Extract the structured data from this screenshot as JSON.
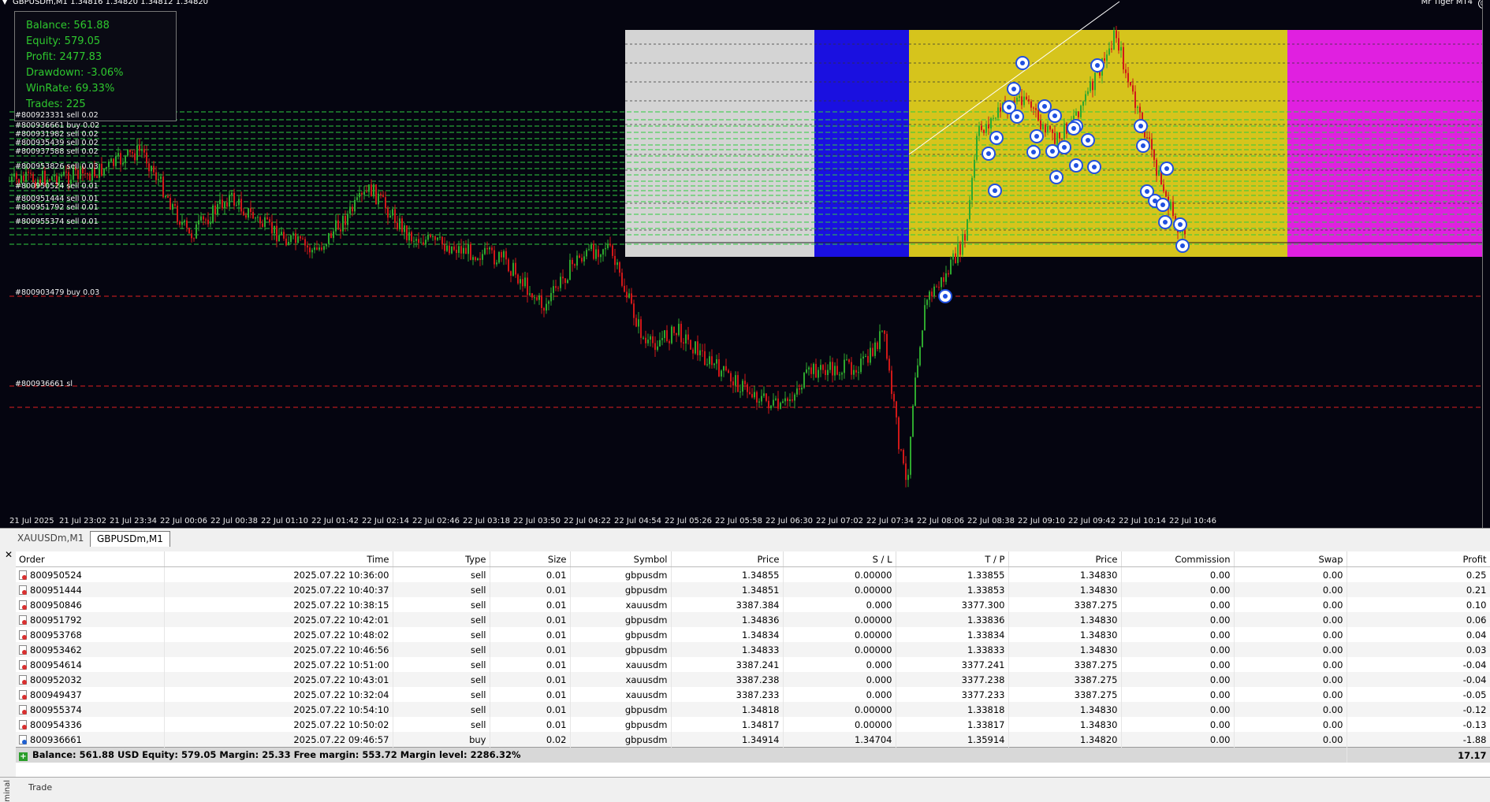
{
  "chart": {
    "symbol_header": "GBPUSDm,M1  1.34816 1.34820 1.34812 1.34820",
    "ea_name": "Mr Tiger MT4",
    "info_panel": [
      "Balance: 561.88",
      "Equity: 579.05",
      "Profit: 2477.83",
      "Drawdown: -3.06%",
      "WinRate: 69.33%",
      "Trades: 225"
    ],
    "order_labels": [
      {
        "text": "#800923331 sell 0.02"
      },
      {
        "text": "#800936661 buy 0.02"
      },
      {
        "text": "#800931982 sell 0.02"
      },
      {
        "text": "#800935439 sell 0.02"
      },
      {
        "text": "#800937588 sell 0.02"
      },
      {
        "text": "#800953826 sell 0.03"
      },
      {
        "text": "#800950524 sell 0.01"
      },
      {
        "text": "#800951444 sell 0.01"
      },
      {
        "text": "#800951792 sell 0.01"
      },
      {
        "text": "#800955374 sell 0.01"
      },
      {
        "text": "#800903479 buy 0.03"
      },
      {
        "text": "#800936661 sl"
      }
    ],
    "time_labels": [
      "21 Jul 2025",
      "21 Jul 23:02",
      "21 Jul 23:34",
      "22 Jul 00:06",
      "22 Jul 00:38",
      "22 Jul 01:10",
      "22 Jul 01:42",
      "22 Jul 02:14",
      "22 Jul 02:46",
      "22 Jul 03:18",
      "22 Jul 03:50",
      "22 Jul 04:22",
      "22 Jul 04:54",
      "22 Jul 05:26",
      "22 Jul 05:58",
      "22 Jul 06:30",
      "22 Jul 07:02",
      "22 Jul 07:34",
      "22 Jul 08:06",
      "22 Jul 08:38",
      "22 Jul 09:10",
      "22 Jul 09:42",
      "22 Jul 10:14",
      "22 Jul 10:46"
    ],
    "zone_colors": {
      "gray": "#d4d4d4",
      "blue": "#1a10e0",
      "yellow": "#d6c41c",
      "magenta": "#e020e0"
    },
    "candle_up_color": "#2ea82e",
    "candle_down_color": "#d01818"
  },
  "tabs": [
    "XAUUSDm,M1",
    "GBPUSDm,M1"
  ],
  "active_tab": "GBPUSDm,M1",
  "terminal": {
    "columns": [
      "Order",
      "Time",
      "Type",
      "Size",
      "Symbol",
      "Price",
      "S / L",
      "T / P",
      "Price",
      "Commission",
      "Swap",
      "Profit"
    ],
    "rows": [
      {
        "order": "800950524",
        "time": "2025.07.22 10:36:00",
        "type": "sell",
        "size": "0.01",
        "symbol": "gbpusdm",
        "price": "1.34855",
        "sl": "0.00000",
        "tp": "1.33855",
        "cur": "1.34830",
        "comm": "0.00",
        "swap": "0.00",
        "profit": "0.25"
      },
      {
        "order": "800951444",
        "time": "2025.07.22 10:40:37",
        "type": "sell",
        "size": "0.01",
        "symbol": "gbpusdm",
        "price": "1.34851",
        "sl": "0.00000",
        "tp": "1.33853",
        "cur": "1.34830",
        "comm": "0.00",
        "swap": "0.00",
        "profit": "0.21"
      },
      {
        "order": "800950846",
        "time": "2025.07.22 10:38:15",
        "type": "sell",
        "size": "0.01",
        "symbol": "xauusdm",
        "price": "3387.384",
        "sl": "0.000",
        "tp": "3377.300",
        "cur": "3387.275",
        "comm": "0.00",
        "swap": "0.00",
        "profit": "0.10"
      },
      {
        "order": "800951792",
        "time": "2025.07.22 10:42:01",
        "type": "sell",
        "size": "0.01",
        "symbol": "gbpusdm",
        "price": "1.34836",
        "sl": "0.00000",
        "tp": "1.33836",
        "cur": "1.34830",
        "comm": "0.00",
        "swap": "0.00",
        "profit": "0.06"
      },
      {
        "order": "800953768",
        "time": "2025.07.22 10:48:02",
        "type": "sell",
        "size": "0.01",
        "symbol": "gbpusdm",
        "price": "1.34834",
        "sl": "0.00000",
        "tp": "1.33834",
        "cur": "1.34830",
        "comm": "0.00",
        "swap": "0.00",
        "profit": "0.04"
      },
      {
        "order": "800953462",
        "time": "2025.07.22 10:46:56",
        "type": "sell",
        "size": "0.01",
        "symbol": "gbpusdm",
        "price": "1.34833",
        "sl": "0.00000",
        "tp": "1.33833",
        "cur": "1.34830",
        "comm": "0.00",
        "swap": "0.00",
        "profit": "0.03"
      },
      {
        "order": "800954614",
        "time": "2025.07.22 10:51:00",
        "type": "sell",
        "size": "0.01",
        "symbol": "xauusdm",
        "price": "3387.241",
        "sl": "0.000",
        "tp": "3377.241",
        "cur": "3387.275",
        "comm": "0.00",
        "swap": "0.00",
        "profit": "-0.04"
      },
      {
        "order": "800952032",
        "time": "2025.07.22 10:43:01",
        "type": "sell",
        "size": "0.01",
        "symbol": "xauusdm",
        "price": "3387.238",
        "sl": "0.000",
        "tp": "3377.238",
        "cur": "3387.275",
        "comm": "0.00",
        "swap": "0.00",
        "profit": "-0.04"
      },
      {
        "order": "800949437",
        "time": "2025.07.22 10:32:04",
        "type": "sell",
        "size": "0.01",
        "symbol": "xauusdm",
        "price": "3387.233",
        "sl": "0.000",
        "tp": "3377.233",
        "cur": "3387.275",
        "comm": "0.00",
        "swap": "0.00",
        "profit": "-0.05"
      },
      {
        "order": "800955374",
        "time": "2025.07.22 10:54:10",
        "type": "sell",
        "size": "0.01",
        "symbol": "gbpusdm",
        "price": "1.34818",
        "sl": "0.00000",
        "tp": "1.33818",
        "cur": "1.34830",
        "comm": "0.00",
        "swap": "0.00",
        "profit": "-0.12"
      },
      {
        "order": "800954336",
        "time": "2025.07.22 10:50:02",
        "type": "sell",
        "size": "0.01",
        "symbol": "gbpusdm",
        "price": "1.34817",
        "sl": "0.00000",
        "tp": "1.33817",
        "cur": "1.34830",
        "comm": "0.00",
        "swap": "0.00",
        "profit": "-0.13"
      },
      {
        "order": "800936661",
        "time": "2025.07.22 09:46:57",
        "type": "buy",
        "size": "0.02",
        "symbol": "gbpusdm",
        "price": "1.34914",
        "sl": "1.34704",
        "tp": "1.35914",
        "cur": "1.34820",
        "comm": "0.00",
        "swap": "0.00",
        "profit": "-1.88"
      }
    ],
    "summary": "Balance: 561.88 USD  Equity: 579.05  Margin: 25.33  Free margin: 553.72  Margin level: 2286.32%",
    "total_profit": "17.17"
  },
  "bottom": {
    "vertical_label": "minal",
    "tab_label": "Trade"
  }
}
